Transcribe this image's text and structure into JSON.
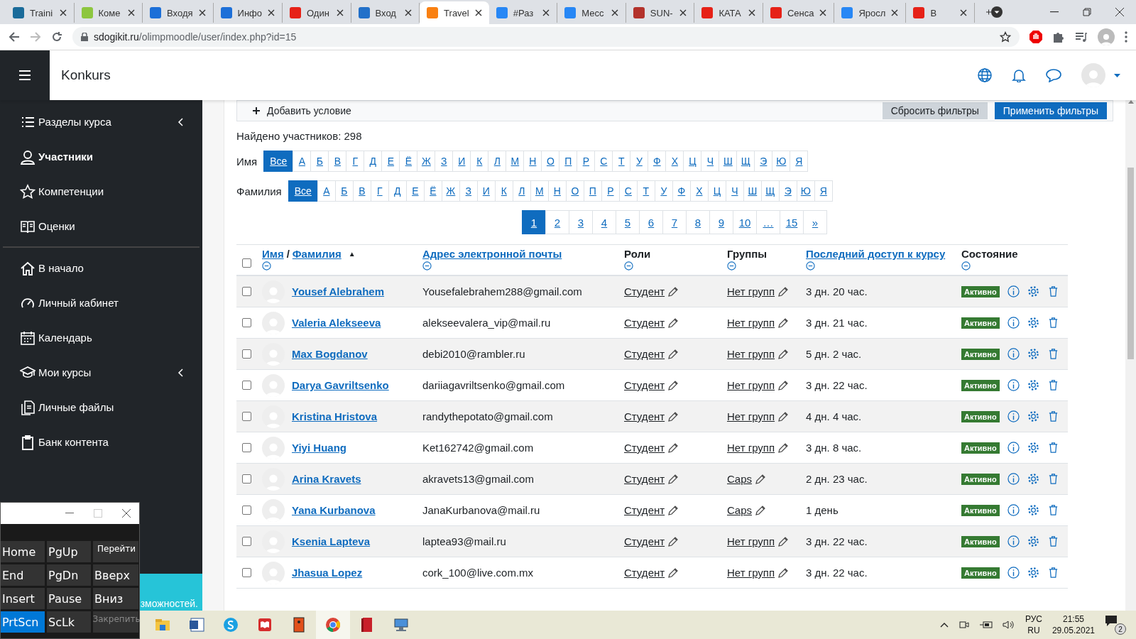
{
  "browser": {
    "tabs": [
      {
        "title": "Traini",
        "color": "#1a6b9a",
        "selected": false
      },
      {
        "title": "Коме",
        "color": "#8dc63f",
        "selected": false
      },
      {
        "title": "Входя",
        "color": "#1c6fd8",
        "selected": false
      },
      {
        "title": "Инфо",
        "color": "#1c6fd8",
        "selected": false
      },
      {
        "title": "Один",
        "color": "#e62117",
        "selected": false
      },
      {
        "title": "Вход",
        "color": "#2270c9",
        "selected": false
      },
      {
        "title": "Travel",
        "color": "#f98012",
        "selected": true
      },
      {
        "title": "#Раз",
        "color": "#2787f5",
        "selected": false
      },
      {
        "title": "Месс",
        "color": "#2787f5",
        "selected": false
      },
      {
        "title": "SUN-",
        "color": "#b3322b",
        "selected": false
      },
      {
        "title": "КАТА",
        "color": "#e62117",
        "selected": false
      },
      {
        "title": "Сенса",
        "color": "#e62117",
        "selected": false
      },
      {
        "title": "Яросл",
        "color": "#2787f5",
        "selected": false
      },
      {
        "title": "В",
        "color": "#e62117",
        "selected": false
      }
    ],
    "url_host": "sdogikit.ru",
    "url_path": "/olimpmoodle/user/index.php?id=15"
  },
  "header": {
    "site_name": "Konkurs"
  },
  "sidebar": {
    "course_items": [
      {
        "label": "Разделы курса",
        "selected": false,
        "collapsible": true
      },
      {
        "label": "Участники",
        "selected": true,
        "collapsible": false
      },
      {
        "label": "Компетенции",
        "selected": false,
        "collapsible": false
      },
      {
        "label": "Оценки",
        "selected": false,
        "collapsible": false
      }
    ],
    "site_items": [
      {
        "label": "В начало",
        "selected": false,
        "collapsible": false
      },
      {
        "label": "Личный кабинет",
        "selected": false,
        "collapsible": false
      },
      {
        "label": "Календарь",
        "selected": false,
        "collapsible": false
      },
      {
        "label": "Мои курсы",
        "selected": false,
        "collapsible": true
      },
      {
        "label": "Личные файлы",
        "selected": false,
        "collapsible": false
      },
      {
        "label": "Банк контента",
        "selected": false,
        "collapsible": false
      }
    ],
    "banner_text": "зможностей."
  },
  "filters": {
    "add_condition": "Добавить условие",
    "reset_button": "Сбросить фильтры",
    "apply_button": "Применить фильтры"
  },
  "found_count": "Найдено участников: 298",
  "letter_bars": [
    {
      "label": "Имя",
      "letters": [
        {
          "text": "Все",
          "selected": true
        },
        {
          "text": "А",
          "selected": false
        },
        {
          "text": "Б",
          "selected": false
        },
        {
          "text": "В",
          "selected": false
        },
        {
          "text": "Г",
          "selected": false
        },
        {
          "text": "Д",
          "selected": false
        },
        {
          "text": "Е",
          "selected": false
        },
        {
          "text": "Ё",
          "selected": false
        },
        {
          "text": "Ж",
          "selected": false
        },
        {
          "text": "З",
          "selected": false
        },
        {
          "text": "И",
          "selected": false
        },
        {
          "text": "К",
          "selected": false
        },
        {
          "text": "Л",
          "selected": false
        },
        {
          "text": "М",
          "selected": false
        },
        {
          "text": "Н",
          "selected": false
        },
        {
          "text": "О",
          "selected": false
        },
        {
          "text": "П",
          "selected": false
        },
        {
          "text": "Р",
          "selected": false
        },
        {
          "text": "С",
          "selected": false
        },
        {
          "text": "Т",
          "selected": false
        },
        {
          "text": "У",
          "selected": false
        },
        {
          "text": "Ф",
          "selected": false
        },
        {
          "text": "Х",
          "selected": false
        },
        {
          "text": "Ц",
          "selected": false
        },
        {
          "text": "Ч",
          "selected": false
        },
        {
          "text": "Ш",
          "selected": false
        },
        {
          "text": "Щ",
          "selected": false
        },
        {
          "text": "Э",
          "selected": false
        },
        {
          "text": "Ю",
          "selected": false
        },
        {
          "text": "Я",
          "selected": false
        }
      ]
    },
    {
      "label": "Фамилия",
      "letters": [
        {
          "text": "Все",
          "selected": true
        },
        {
          "text": "А",
          "selected": false
        },
        {
          "text": "Б",
          "selected": false
        },
        {
          "text": "В",
          "selected": false
        },
        {
          "text": "Г",
          "selected": false
        },
        {
          "text": "Д",
          "selected": false
        },
        {
          "text": "Е",
          "selected": false
        },
        {
          "text": "Ё",
          "selected": false
        },
        {
          "text": "Ж",
          "selected": false
        },
        {
          "text": "З",
          "selected": false
        },
        {
          "text": "И",
          "selected": false
        },
        {
          "text": "К",
          "selected": false
        },
        {
          "text": "Л",
          "selected": false
        },
        {
          "text": "М",
          "selected": false
        },
        {
          "text": "Н",
          "selected": false
        },
        {
          "text": "О",
          "selected": false
        },
        {
          "text": "П",
          "selected": false
        },
        {
          "text": "Р",
          "selected": false
        },
        {
          "text": "С",
          "selected": false
        },
        {
          "text": "Т",
          "selected": false
        },
        {
          "text": "У",
          "selected": false
        },
        {
          "text": "Ф",
          "selected": false
        },
        {
          "text": "Х",
          "selected": false
        },
        {
          "text": "Ц",
          "selected": false
        },
        {
          "text": "Ч",
          "selected": false
        },
        {
          "text": "Ш",
          "selected": false
        },
        {
          "text": "Щ",
          "selected": false
        },
        {
          "text": "Э",
          "selected": false
        },
        {
          "text": "Ю",
          "selected": false
        },
        {
          "text": "Я",
          "selected": false
        }
      ]
    }
  ],
  "pagination": [
    {
      "text": "1",
      "selected": true
    },
    {
      "text": "2",
      "selected": false
    },
    {
      "text": "3",
      "selected": false
    },
    {
      "text": "4",
      "selected": false
    },
    {
      "text": "5",
      "selected": false
    },
    {
      "text": "6",
      "selected": false
    },
    {
      "text": "7",
      "selected": false
    },
    {
      "text": "8",
      "selected": false
    },
    {
      "text": "9",
      "selected": false
    },
    {
      "text": "10",
      "selected": false
    },
    {
      "text": "…",
      "selected": false
    },
    {
      "text": "15",
      "selected": false
    },
    {
      "text": "»",
      "selected": false
    }
  ],
  "table": {
    "select_all_checked": false,
    "name_header": {
      "first": "Имя",
      "separator": "/",
      "last": "Фамилия",
      "sort_mark": "▲"
    },
    "columns": [
      {
        "label": "Адрес электронной почты",
        "link": true
      },
      {
        "label": "Роли",
        "link": false
      },
      {
        "label": "Группы",
        "link": false
      },
      {
        "label": "Последний доступ к курсу",
        "link": true
      },
      {
        "label": "Состояние",
        "link": false
      }
    ],
    "rows": [
      {
        "checked": false,
        "name": "Yousef Alebrahem",
        "email": "Yousefalebrahem288@gmail.com",
        "role": "Студент",
        "group": "Нет групп",
        "last_access": "3 дн. 20 час.",
        "status": "Активно"
      },
      {
        "checked": false,
        "name": "Valeria Alekseeva",
        "email": "alekseevalera_vip@mail.ru",
        "role": "Студент",
        "group": "Нет групп",
        "last_access": "3 дн. 21 час.",
        "status": "Активно"
      },
      {
        "checked": false,
        "name": "Max Bogdanov",
        "email": "debi2010@rambler.ru",
        "role": "Студент",
        "group": "Нет групп",
        "last_access": "5 дн. 2 час.",
        "status": "Активно"
      },
      {
        "checked": false,
        "name": "Darya Gavriltsenko",
        "email": "dariiagavriltsenko@gmail.com",
        "role": "Студент",
        "group": "Нет групп",
        "last_access": "3 дн. 22 час.",
        "status": "Активно"
      },
      {
        "checked": false,
        "name": "Kristina Hristova",
        "email": "randythepotato@gmail.com",
        "role": "Студент",
        "group": "Нет групп",
        "last_access": "4 дн. 4 час.",
        "status": "Активно"
      },
      {
        "checked": false,
        "name": "Yiyi Huang",
        "email": "Ket162742@gmail.com",
        "role": "Студент",
        "group": "Нет групп",
        "last_access": "3 дн. 8 час.",
        "status": "Активно"
      },
      {
        "checked": false,
        "name": "Arina Kravets",
        "email": "akravets13@gmail.com",
        "role": "Студент",
        "group": "Caps",
        "last_access": "2 дн. 23 час.",
        "status": "Активно"
      },
      {
        "checked": false,
        "name": "Yana Kurbanova",
        "email": "JanaKurbanova@mail.ru",
        "role": "Студент",
        "group": "Caps",
        "last_access": "1 день",
        "status": "Активно"
      },
      {
        "checked": false,
        "name": "Ksenia Lapteva",
        "email": "laptea93@mail.ru",
        "role": "Студент",
        "group": "Нет групп",
        "last_access": "3 дн. 22 час.",
        "status": "Активно"
      },
      {
        "checked": false,
        "name": "Jhasua Lopez",
        "email": "cork_100@live.com.mx",
        "role": "Студент",
        "group": "Нет групп",
        "last_access": "3 дн. 22 час.",
        "status": "Активно"
      }
    ]
  },
  "keyboard": {
    "keys": [
      {
        "label": "Home",
        "kind": "large",
        "selected": false,
        "disabled": false
      },
      {
        "label": "PgUp",
        "kind": "large",
        "selected": false,
        "disabled": false
      },
      {
        "label": "Перейти",
        "kind": "small",
        "selected": false,
        "disabled": false
      },
      {
        "label": "End",
        "kind": "large",
        "selected": false,
        "disabled": false
      },
      {
        "label": "PgDn",
        "kind": "large",
        "selected": false,
        "disabled": false
      },
      {
        "label": "Вверх",
        "kind": "large",
        "selected": false,
        "disabled": false
      },
      {
        "label": "Insert",
        "kind": "large",
        "selected": false,
        "disabled": false
      },
      {
        "label": "Pause",
        "kind": "large",
        "selected": false,
        "disabled": false
      },
      {
        "label": "Вниз",
        "kind": "large",
        "selected": false,
        "disabled": false
      },
      {
        "label": "PrtScn",
        "kind": "large",
        "selected": true,
        "disabled": false
      },
      {
        "label": "ScLk",
        "kind": "large",
        "selected": false,
        "disabled": false
      },
      {
        "label": "Закрепить",
        "kind": "small",
        "selected": false,
        "disabled": true
      }
    ]
  },
  "taskbar": {
    "apps": [
      {
        "selected": false
      },
      {
        "selected": false
      },
      {
        "selected": false
      },
      {
        "selected": false
      },
      {
        "selected": false
      },
      {
        "selected": true
      },
      {
        "selected": false
      },
      {
        "selected": false
      }
    ],
    "language": "РУС",
    "layout": "RU",
    "time": "21:55",
    "date": "29.05.2021",
    "notification_count": "2"
  }
}
